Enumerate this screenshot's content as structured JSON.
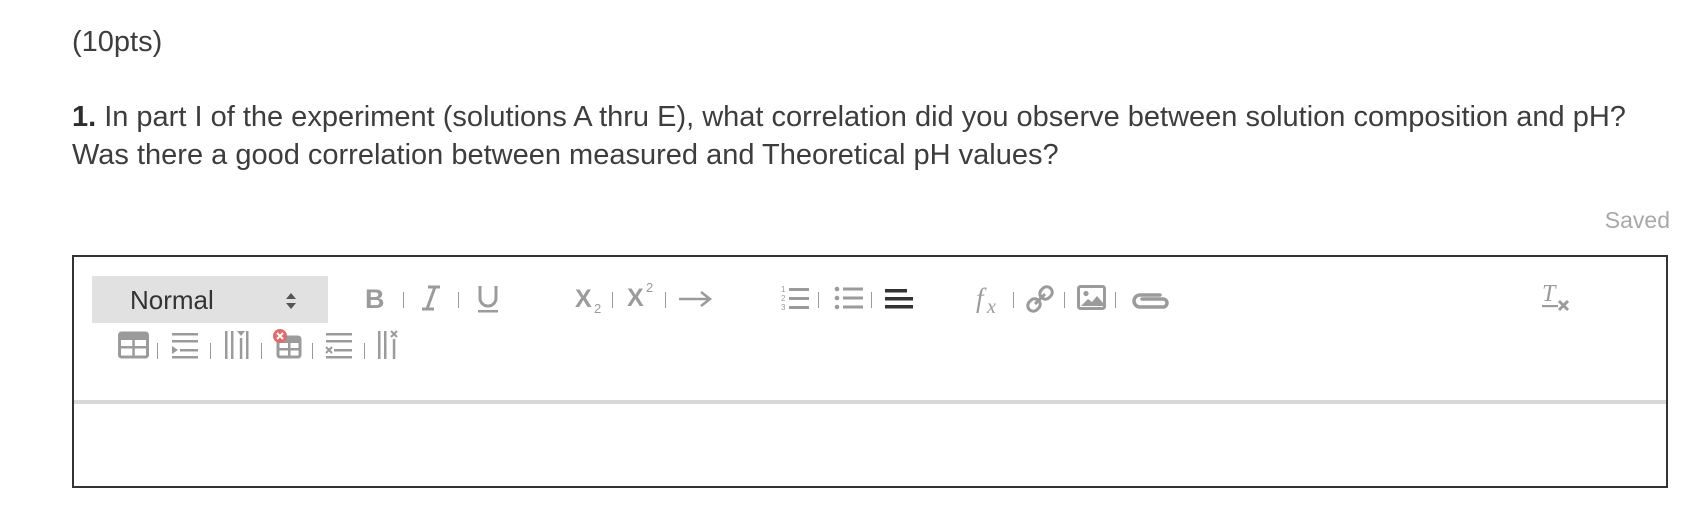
{
  "question": {
    "points": "(10pts)",
    "number": "1.",
    "text": "In part I of the experiment (solutions A thru E), what correlation did you observe between solution composition and pH? Was there a good correlation between measured and Theoretical pH values?"
  },
  "status": {
    "saved_label": "Saved"
  },
  "editor": {
    "format_select": {
      "value": "Normal"
    },
    "content": ""
  },
  "colors": {
    "icon_gray": "#9b9b9b",
    "icon_dark": "#333333",
    "select_bg": "#e1e1e1",
    "remove_badge": "#e06b6b"
  }
}
